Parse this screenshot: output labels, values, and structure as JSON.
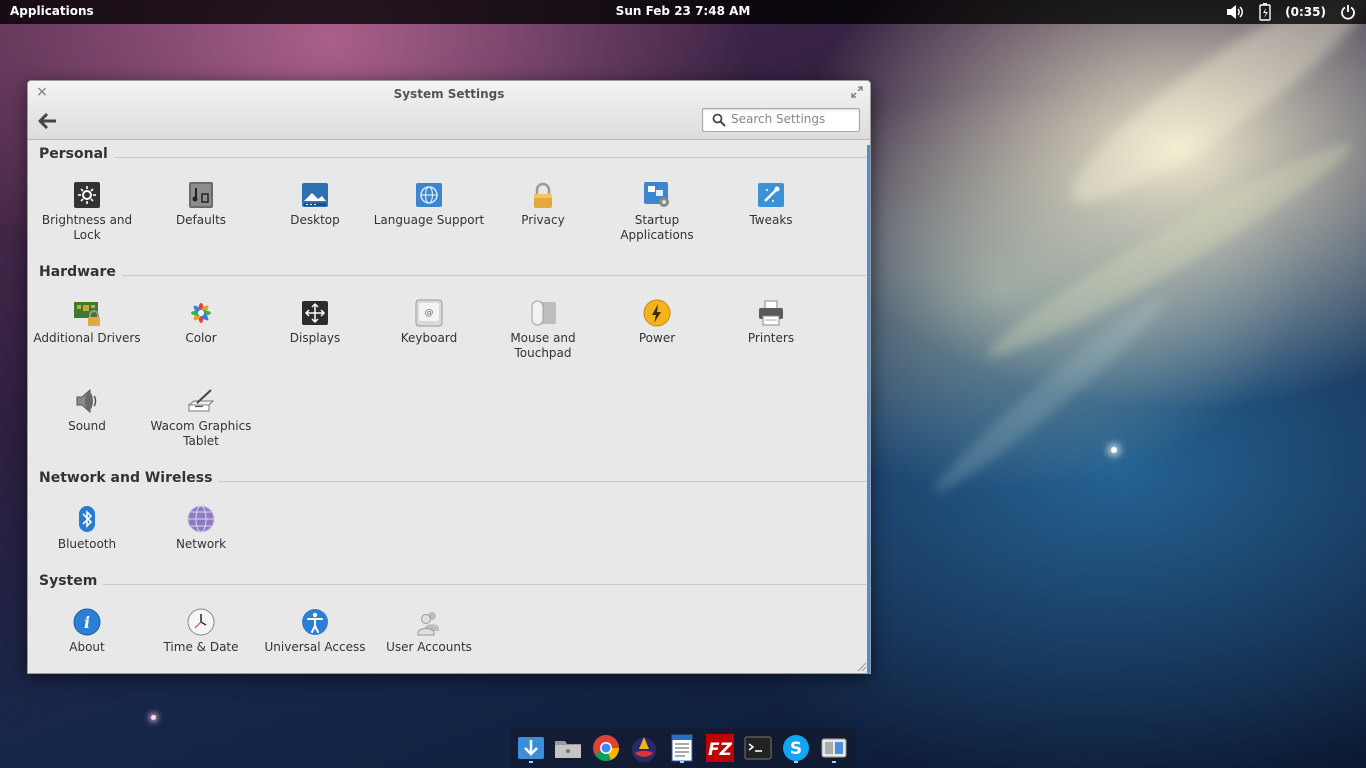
{
  "top_panel": {
    "applications_label": "Applications",
    "clock": "Sun Feb 23  7:48 AM",
    "battery_text": "(0:35)",
    "icons": [
      "volume-icon",
      "battery-icon",
      "power-icon"
    ]
  },
  "window": {
    "title": "System Settings",
    "search_placeholder": "Search Settings"
  },
  "sections": [
    {
      "title": "Personal",
      "items": [
        {
          "label": "Brightness and Lock",
          "icon": "brightness-lock-icon"
        },
        {
          "label": "Defaults",
          "icon": "defaults-icon"
        },
        {
          "label": "Desktop",
          "icon": "desktop-icon"
        },
        {
          "label": "Language Support",
          "icon": "language-icon"
        },
        {
          "label": "Privacy",
          "icon": "privacy-lock-icon"
        },
        {
          "label": "Startup Applications",
          "icon": "startup-apps-icon"
        },
        {
          "label": "Tweaks",
          "icon": "tweaks-icon"
        }
      ]
    },
    {
      "title": "Hardware",
      "items": [
        {
          "label": "Additional Drivers",
          "icon": "drivers-icon"
        },
        {
          "label": "Color",
          "icon": "color-icon"
        },
        {
          "label": "Displays",
          "icon": "displays-icon"
        },
        {
          "label": "Keyboard",
          "icon": "keyboard-icon"
        },
        {
          "label": "Mouse and Touchpad",
          "icon": "mouse-icon"
        },
        {
          "label": "Power",
          "icon": "power-bolt-icon"
        },
        {
          "label": "Printers",
          "icon": "printer-icon"
        },
        {
          "label": "Sound",
          "icon": "speaker-icon"
        },
        {
          "label": "Wacom Graphics Tablet",
          "icon": "tablet-icon"
        }
      ]
    },
    {
      "title": "Network and Wireless",
      "items": [
        {
          "label": "Bluetooth",
          "icon": "bluetooth-icon"
        },
        {
          "label": "Network",
          "icon": "network-globe-icon"
        }
      ]
    },
    {
      "title": "System",
      "items": [
        {
          "label": "About",
          "icon": "info-icon"
        },
        {
          "label": "Time & Date",
          "icon": "clock-icon"
        },
        {
          "label": "Universal Access",
          "icon": "accessibility-icon"
        },
        {
          "label": "User Accounts",
          "icon": "users-icon"
        }
      ]
    }
  ],
  "dock": {
    "items": [
      {
        "name": "app-center",
        "icon": "app-center-icon"
      },
      {
        "name": "files",
        "icon": "folder-icon"
      },
      {
        "name": "chrome",
        "icon": "chrome-icon"
      },
      {
        "name": "app-launcher",
        "icon": "launcher-icon"
      },
      {
        "name": "text-editor",
        "icon": "document-icon"
      },
      {
        "name": "filezilla",
        "icon": "filezilla-icon"
      },
      {
        "name": "terminal",
        "icon": "terminal-icon"
      },
      {
        "name": "skype",
        "icon": "skype-icon"
      },
      {
        "name": "system-settings",
        "icon": "settings-switch-icon"
      }
    ]
  },
  "colors": {
    "accent": "#4a90d9",
    "panel_bg": "#000000",
    "window_bg": "#e8e8e8"
  }
}
